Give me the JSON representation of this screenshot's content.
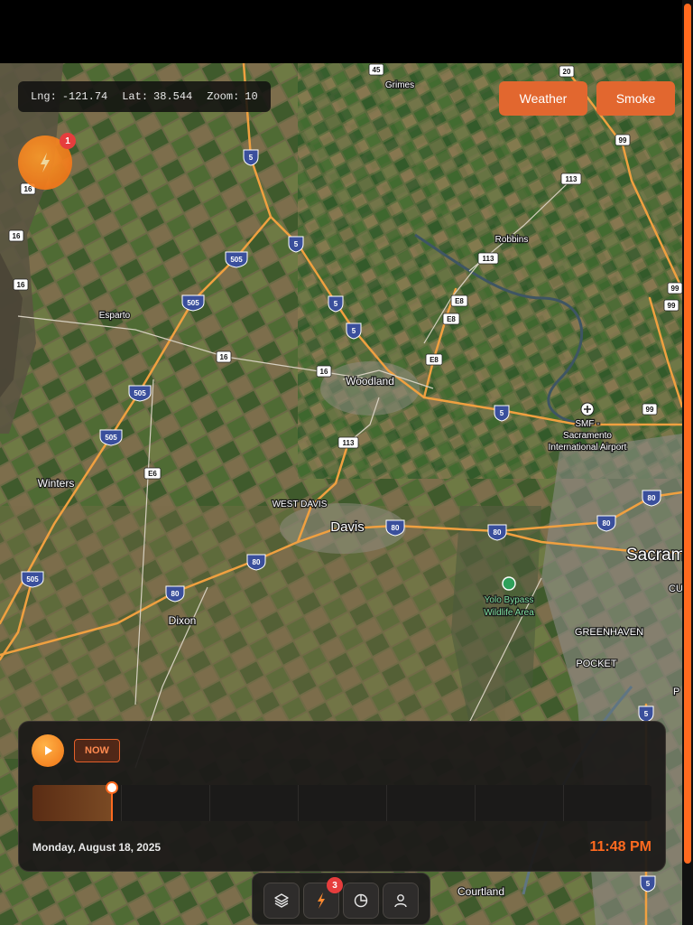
{
  "map": {
    "coords": {
      "lng_label": "Lng:",
      "lng_value": "-121.74",
      "lat_label": "Lat:",
      "lat_value": "38.544",
      "zoom_label": "Zoom:",
      "zoom_value": "10"
    },
    "overlay_buttons": {
      "weather": "Weather",
      "smoke": "Smoke"
    },
    "fire_cluster": {
      "count": "1"
    },
    "places": {
      "grimes": "Grimes",
      "robbins": "Robbins",
      "esparto": "Esparto",
      "woodland": "Woodland",
      "smf_line1": "SMF -",
      "smf_line2": "Sacramento",
      "smf_line3": "International Airport",
      "winters": "Winters",
      "west_davis": "WEST DAVIS",
      "davis": "Davis",
      "sacramento": "Sacram",
      "dixon": "Dixon",
      "yolo_line1": "Yolo Bypass",
      "yolo_line2": "Wildlife Area",
      "greenhaven": "GREENHAVEN",
      "pocket": "POCKET",
      "courtland": "Courtland",
      "cu": "CU",
      "p": "P"
    },
    "shields": {
      "h45": "45",
      "h20": "20",
      "h99a": "99",
      "h113a": "113",
      "i5a": "5",
      "h16a": "16",
      "h16b": "16",
      "h16c": "16",
      "i505a": "505",
      "i5b": "5",
      "i5c": "5",
      "i5d": "5",
      "i505b": "505",
      "h113b": "113",
      "h99b": "99",
      "h99c": "99",
      "e8a": "E8",
      "e8b": "E8",
      "e8c": "E8",
      "h16d": "16",
      "h16e": "16",
      "i505c": "505",
      "i5e": "5",
      "h99d": "99",
      "i505d": "505",
      "h113c": "113",
      "e6": "E6",
      "i80a": "80",
      "i80b": "80",
      "i80c": "80",
      "i80d": "80",
      "i505e": "505",
      "i80e": "80",
      "i80f": "80",
      "i5f": "5",
      "i5g": "5"
    }
  },
  "timeline": {
    "now_label": "NOW",
    "date": "Monday, August 18, 2025",
    "time": "11:48 PM",
    "progress": 0.128
  },
  "toolbar": {
    "fire_badge": "3"
  },
  "colors": {
    "accent": "#ff6a1f",
    "button": "#e2672f",
    "badge": "#e63d3d"
  }
}
